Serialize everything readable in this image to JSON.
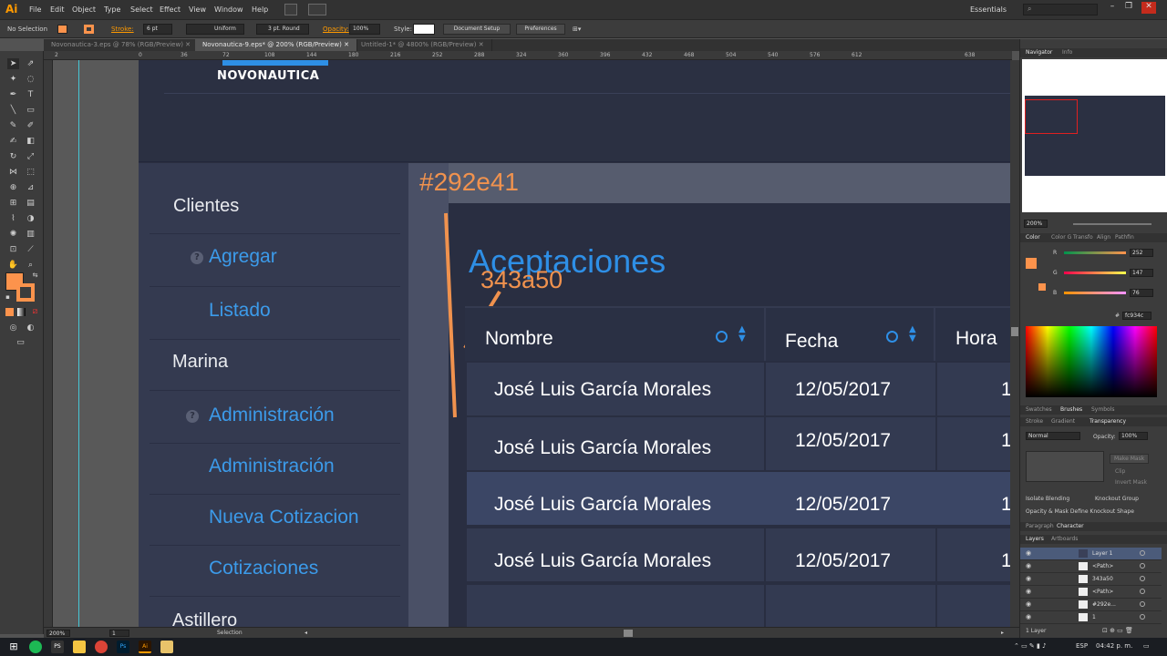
{
  "app": {
    "logo": "Ai",
    "workspace": "Essentials"
  },
  "menu": [
    "File",
    "Edit",
    "Object",
    "Type",
    "Select",
    "Effect",
    "View",
    "Window",
    "Help"
  ],
  "control_bar": {
    "selection": "No Selection",
    "stroke_label": "Stroke:",
    "stroke_value": "6 pt",
    "uniform": "Uniform",
    "brush": "3 pt. Round",
    "opacity_label": "Opacity:",
    "opacity_value": "100%",
    "style_label": "Style:",
    "doc_setup": "Document Setup",
    "preferences": "Preferences"
  },
  "tabs": [
    {
      "label": "Novonautica-3.eps @ 78% (RGB/Preview)",
      "active": false
    },
    {
      "label": "Novonautica-9.eps* @ 200% (RGB/Preview)",
      "active": true
    },
    {
      "label": "Untitled-1* @ 4800% (RGB/Preview)",
      "active": false
    }
  ],
  "ruler_labels": [
    "2",
    "0",
    "36",
    "72",
    "108",
    "144",
    "180",
    "216",
    "252",
    "288",
    "324",
    "360",
    "396",
    "432",
    "468",
    "504",
    "540",
    "576",
    "612",
    "638"
  ],
  "artboard": {
    "brand": "NOVONAUTICA",
    "label_bg": "#292e41",
    "label_cell": "343a50",
    "title": "Aceptaciones",
    "sidebar": [
      {
        "label": "Clientes",
        "kind": "head",
        "icon": false
      },
      {
        "label": "Agregar",
        "kind": "link",
        "icon": true
      },
      {
        "label": "Listado",
        "kind": "link",
        "icon": false
      },
      {
        "label": "Marina",
        "kind": "head",
        "icon": false
      },
      {
        "label": "Administración",
        "kind": "link",
        "icon": true
      },
      {
        "label": "Administración",
        "kind": "link",
        "icon": false
      },
      {
        "label": "Nueva Cotizacion",
        "kind": "link",
        "icon": false
      },
      {
        "label": "Cotizaciones",
        "kind": "link",
        "icon": false
      },
      {
        "label": "Astillero",
        "kind": "head",
        "icon": false
      }
    ],
    "table": {
      "columns": [
        "Nombre",
        "Fecha",
        "Hora"
      ],
      "rows": [
        {
          "nombre": "José Luis García Morales",
          "fecha": "12/05/2017",
          "hora": "1",
          "highlight": false
        },
        {
          "nombre": "José Luis García Morales",
          "fecha": "12/05/2017",
          "hora": "1",
          "highlight": false
        },
        {
          "nombre": "José Luis García Morales",
          "fecha": "12/05/2017",
          "hora": "1",
          "highlight": true
        },
        {
          "nombre": "José Luis García Morales",
          "fecha": "12/05/2017",
          "hora": "1",
          "highlight": false
        }
      ]
    }
  },
  "status": {
    "zoom": "200%",
    "page": "1",
    "mode": "Selection"
  },
  "right_panel": {
    "nav_tabs": [
      "Navigator",
      "Info"
    ],
    "nav_zoom": "200%",
    "color_tabs": [
      "Color",
      "Color G",
      "Transfo",
      "Align",
      "Pathfin"
    ],
    "rgb": [
      {
        "ch": "R",
        "value": "252"
      },
      {
        "ch": "G",
        "value": "147"
      },
      {
        "ch": "B",
        "value": "76"
      }
    ],
    "hex": "fc934c",
    "swatch_tabs": [
      "Swatches",
      "Brushes",
      "Symbols"
    ],
    "transp_tabs": [
      "Stroke",
      "Gradient",
      "Transparency"
    ],
    "blend": "Normal",
    "opacity_label": "Opacity:",
    "opacity_value": "100%",
    "make_mask": "Make Mask",
    "clip": "Clip",
    "invert_mask": "Invert Mask",
    "isolate": "Isolate Blending",
    "knockout": "Knockout Group",
    "opacity_mask": "Opacity & Mask Define Knockout Shape",
    "char_tabs": [
      "Paragraph",
      "Character"
    ],
    "layers_tabs": [
      "Layers",
      "Artboards"
    ],
    "layers": [
      "Layer 1",
      "<Path>",
      "343a50",
      "<Path>",
      "#292e...",
      "1"
    ],
    "layers_count": "1 Layer"
  },
  "taskbar": {
    "lang": "ESP",
    "time": "04:42 p. m."
  },
  "colors": {
    "accent": "#ff9a00",
    "link_blue": "#2e8fe6",
    "annotation_orange": "#f0924e",
    "fill_swatch": "#fc934c"
  }
}
